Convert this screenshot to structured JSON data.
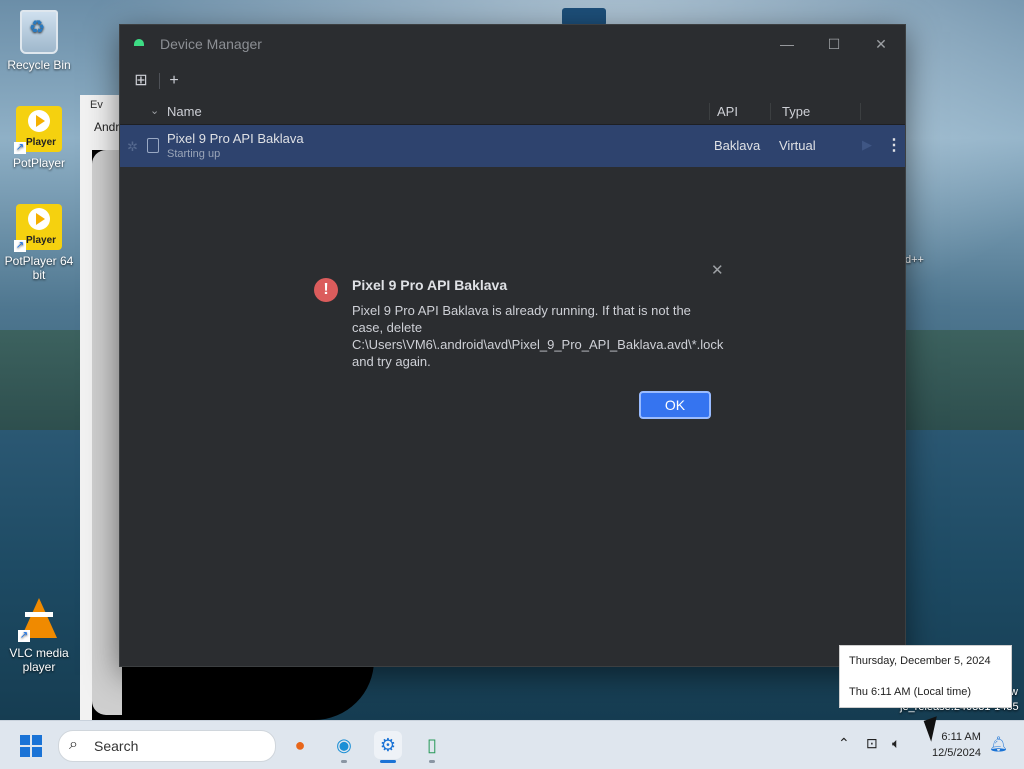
{
  "desktop": {
    "icons": [
      {
        "label": "Recycle Bin"
      },
      {
        "label": "PotPlayer"
      },
      {
        "label": "PotPlayer 64 bit"
      },
      {
        "label": "VLC media player"
      }
    ],
    "pot_badge": "Player",
    "bg_window_title": "Ev",
    "bg_window_text": "Andr",
    "right_label": "d++",
    "right_label2": "w",
    "right_label3": "je_release:240331-1435"
  },
  "window": {
    "title": "Device Manager",
    "minimize": "—",
    "maximize": "☐",
    "close": "✕",
    "toolbar": {
      "pair_icon": "⊞",
      "add": "+"
    },
    "columns": {
      "name": "Name",
      "api": "API",
      "type": "Type"
    },
    "devices": [
      {
        "name": "Pixel 9 Pro API Baklava",
        "status": "Starting up",
        "api": "Baklava",
        "type": "Virtual"
      }
    ]
  },
  "dialog": {
    "title": "Pixel 9 Pro API Baklava",
    "message": "Pixel 9 Pro API Baklava is already running. If that is not the case, delete C:\\Users\\VM6\\.android\\avd\\Pixel_9_Pro_API_Baklava.avd\\*.lock and try again.",
    "ok_label": "OK",
    "close": "✕"
  },
  "tooltip": {
    "date_line": "Thursday, December 5, 2024",
    "time_line": "Thu 6:11 AM (Local time)"
  },
  "taskbar": {
    "search_placeholder": "Search",
    "clock_time": "6:11 AM",
    "clock_date": "12/5/2024"
  },
  "colors": {
    "accent": "#3574f0",
    "selection": "#2e436e",
    "error": "#db5c5c"
  }
}
